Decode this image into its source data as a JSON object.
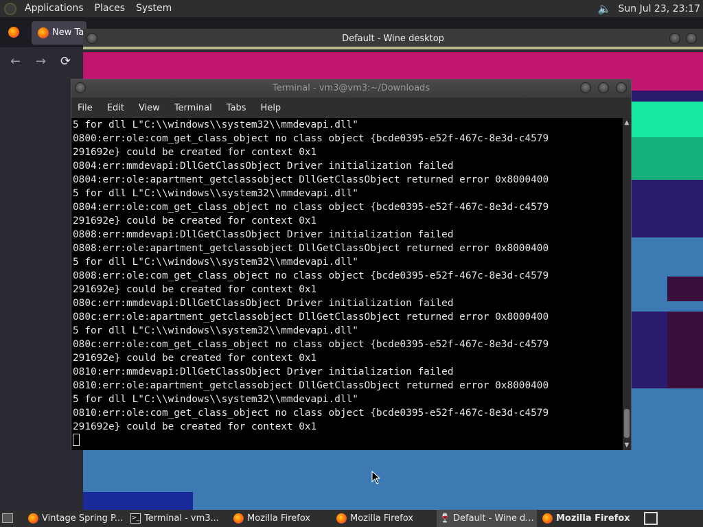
{
  "top_panel": {
    "menus": [
      "Applications",
      "Places",
      "System"
    ],
    "clock": "Sun Jul 23, 23:17",
    "speaker_icon": "speaker-icon"
  },
  "firefox": {
    "tab_label": "New Ta",
    "back_icon": "←",
    "forward_icon": "→",
    "reload_icon": "⟳"
  },
  "wine": {
    "title": "Default - Wine desktop"
  },
  "terminal": {
    "title": "Terminal - vm3@vm3:~/Downloads",
    "menu": [
      "File",
      "Edit",
      "View",
      "Terminal",
      "Tabs",
      "Help"
    ],
    "lines": [
      "5 for dll L\"C:\\\\windows\\\\system32\\\\mmdevapi.dll\"",
      "0800:err:ole:com_get_class_object no class object {bcde0395-e52f-467c-8e3d-c4579",
      "291692e} could be created for context 0x1",
      "0804:err:mmdevapi:DllGetClassObject Driver initialization failed",
      "0804:err:ole:apartment_getclassobject DllGetClassObject returned error 0x8000400",
      "5 for dll L\"C:\\\\windows\\\\system32\\\\mmdevapi.dll\"",
      "0804:err:ole:com_get_class_object no class object {bcde0395-e52f-467c-8e3d-c4579",
      "291692e} could be created for context 0x1",
      "0808:err:mmdevapi:DllGetClassObject Driver initialization failed",
      "0808:err:ole:apartment_getclassobject DllGetClassObject returned error 0x8000400",
      "5 for dll L\"C:\\\\windows\\\\system32\\\\mmdevapi.dll\"",
      "0808:err:ole:com_get_class_object no class object {bcde0395-e52f-467c-8e3d-c4579",
      "291692e} could be created for context 0x1",
      "080c:err:mmdevapi:DllGetClassObject Driver initialization failed",
      "080c:err:ole:apartment_getclassobject DllGetClassObject returned error 0x8000400",
      "5 for dll L\"C:\\\\windows\\\\system32\\\\mmdevapi.dll\"",
      "080c:err:ole:com_get_class_object no class object {bcde0395-e52f-467c-8e3d-c4579",
      "291692e} could be created for context 0x1",
      "0810:err:mmdevapi:DllGetClassObject Driver initialization failed",
      "0810:err:ole:apartment_getclassobject DllGetClassObject returned error 0x8000400",
      "5 for dll L\"C:\\\\windows\\\\system32\\\\mmdevapi.dll\"",
      "0810:err:ole:com_get_class_object no class object {bcde0395-e52f-467c-8e3d-c4579",
      "291692e} could be created for context 0x1"
    ]
  },
  "taskbar": {
    "tasks": [
      {
        "label": "Vintage Spring P...",
        "icon": "firefox-icon",
        "active": false,
        "bold": false
      },
      {
        "label": "Terminal - vm3...",
        "icon": "terminal-icon",
        "active": false,
        "bold": false
      },
      {
        "label": "Mozilla Firefox",
        "icon": "firefox-icon",
        "active": false,
        "bold": false
      },
      {
        "label": "Mozilla Firefox",
        "icon": "firefox-icon",
        "active": false,
        "bold": false
      },
      {
        "label": "Default - Wine d...",
        "icon": "wine-icon",
        "active": true,
        "bold": false
      },
      {
        "label": "Mozilla Firefox",
        "icon": "firefox-icon",
        "active": false,
        "bold": true
      }
    ]
  },
  "colors": {
    "wine_bg": "#3d79b3",
    "magenta": "#c0166f",
    "teal": "#18e6a3",
    "indigo": "#2a1a6e",
    "maroon": "#3a0f3c"
  }
}
